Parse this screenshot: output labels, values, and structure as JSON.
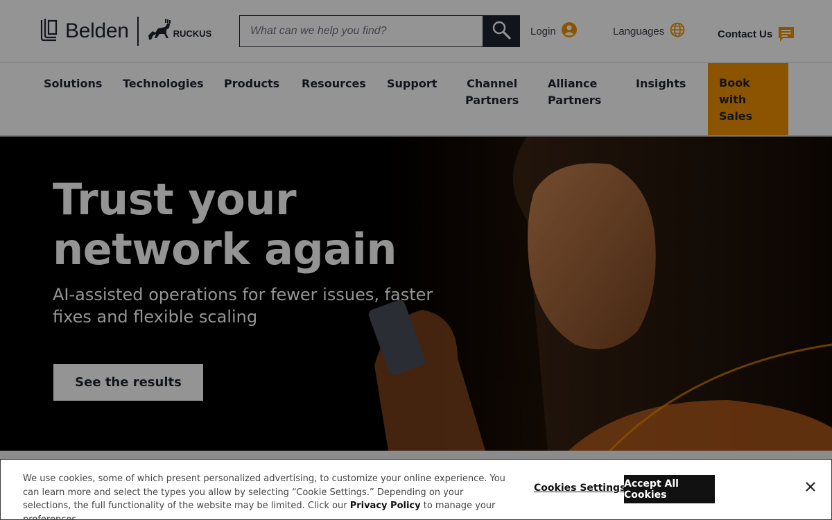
{
  "header": {
    "brand_primary": "Belden",
    "brand_secondary": "RUCKUS",
    "search_placeholder": "What can we help you find?",
    "login_label": "Login",
    "languages_label": "Languages",
    "contact_label": "Contact Us"
  },
  "nav": {
    "items": [
      {
        "label": "Solutions"
      },
      {
        "label": "Technologies"
      },
      {
        "label": "Products"
      },
      {
        "label": "Resources"
      },
      {
        "label": "Support"
      },
      {
        "label_line1": "Channel",
        "label_line2": "Partners"
      },
      {
        "label_line1": "Alliance",
        "label_line2": "Partners"
      },
      {
        "label": "Insights"
      }
    ],
    "book": {
      "line1": "Book",
      "line2": "with",
      "line3": "Sales"
    }
  },
  "hero": {
    "title_line1": "Trust your",
    "title_line2": "network again",
    "subtitle": "AI-assisted operations for fewer issues, faster fixes and flexible scaling",
    "cta_label": "See the results"
  },
  "cookie": {
    "text_before_link": "We use cookies, some of which present personalized advertising, to customize your online experience. You can learn more and select the types you allow by selecting “Cookie Settings.” Depending on your selections, the full functionality of the website may be limited. Click our",
    "privacy_link": "Privacy Policy",
    "text_after_link": "to manage your preferences.",
    "settings_label": "Cookies Settings",
    "accept_label": "Accept All Cookies"
  },
  "colors": {
    "brand_dark": "#1e2430",
    "accent_orange": "#f39200",
    "hero_bg": "#000000"
  },
  "icons": {
    "search": "search-icon",
    "login": "user-circle-icon",
    "languages": "globe-icon",
    "contact": "chat-icon",
    "close": "close-icon"
  }
}
